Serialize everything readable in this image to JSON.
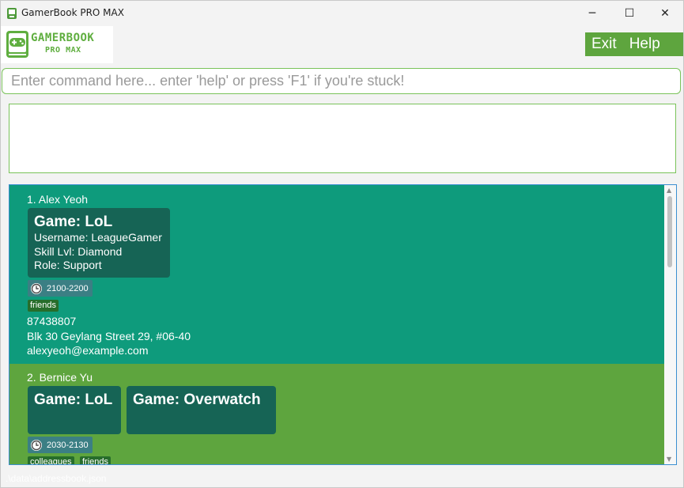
{
  "window": {
    "title": "GamerBook PRO MAX",
    "controls": {
      "minimize": "─",
      "maximize": "☐",
      "close": "✕"
    }
  },
  "logo": {
    "title": "GAMERBOOK",
    "subtitle": "PRO MAX"
  },
  "menu": {
    "exit": "Exit",
    "help": "Help"
  },
  "command": {
    "placeholder": "Enter command here... enter 'help' or press 'F1' if you're stuck!",
    "value": ""
  },
  "result": {
    "text": ""
  },
  "persons": [
    {
      "name": "1. Alex Yeoh",
      "games": [
        {
          "title": "Game: LoL",
          "username": "Username: LeagueGamer",
          "skill": "Skill Lvl: Diamond",
          "role": "Role: Support"
        }
      ],
      "time": "2100-2200",
      "tags": [
        "friends"
      ],
      "phone": "87438807",
      "address": "Blk 30 Geylang Street 29, #06-40",
      "email": "alexyeoh@example.com"
    },
    {
      "name": "2. Bernice Yu",
      "games": [
        {
          "title": "Game: LoL"
        },
        {
          "title": "Game: Overwatch"
        }
      ],
      "time": "2030-2130",
      "tags": [
        "colleagues",
        "friends"
      ]
    }
  ],
  "status": {
    "path": ".\\data\\addressbook.json"
  },
  "colors": {
    "accent": "#5ea53e",
    "card1_bg": "#0e9b7c",
    "card2_bg": "#5ea53e",
    "game_box": "#166455",
    "time_badge": "#3b7f84",
    "tag": "#276d2b"
  }
}
